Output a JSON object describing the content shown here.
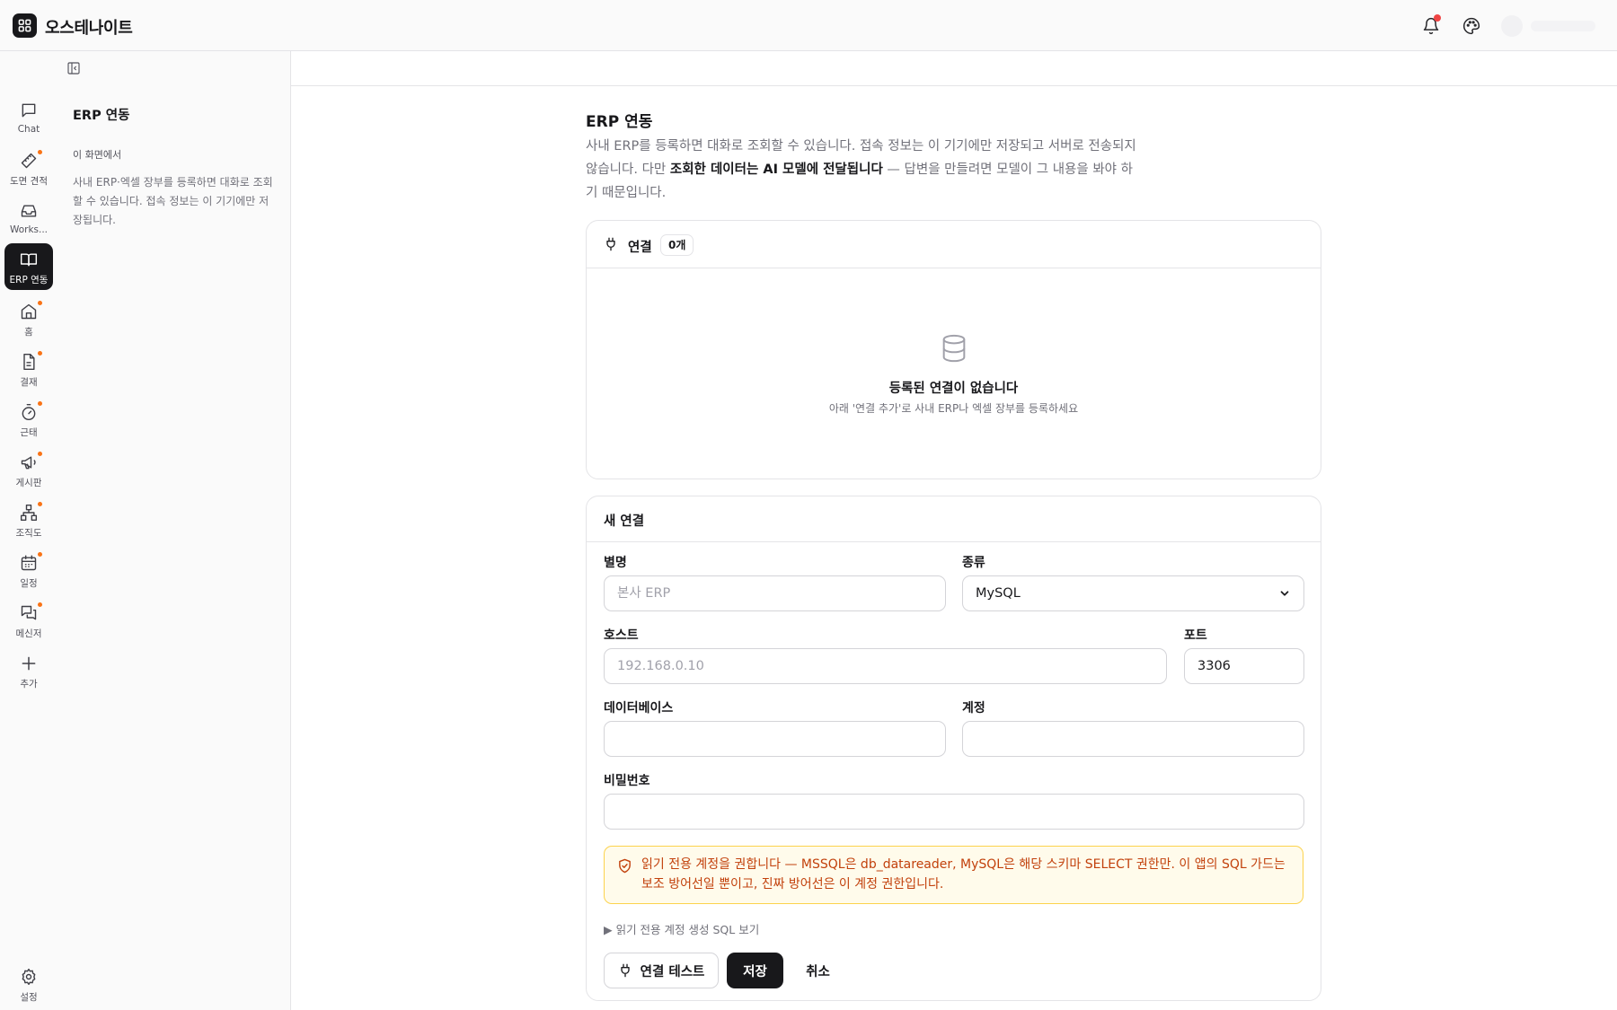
{
  "app": {
    "name": "오스테나이트"
  },
  "topbar": {
    "icons": [
      "bell-icon",
      "palette-icon"
    ],
    "notification_dot_color": "#ef4444"
  },
  "rail": {
    "items": [
      {
        "label": "Chat",
        "icon": "chat-icon",
        "badge": false,
        "active": false
      },
      {
        "label": "도면 견적",
        "icon": "ruler-icon",
        "badge": true,
        "active": false
      },
      {
        "label": "Works...",
        "icon": "inbox-icon",
        "badge": false,
        "active": false
      },
      {
        "label": "ERP 연동",
        "icon": "book-open-icon",
        "badge": false,
        "active": true
      },
      {
        "label": "홈",
        "icon": "home-icon",
        "badge": true,
        "active": false
      },
      {
        "label": "결재",
        "icon": "document-icon",
        "badge": true,
        "active": false
      },
      {
        "label": "근태",
        "icon": "timer-icon",
        "badge": true,
        "active": false
      },
      {
        "label": "게시판",
        "icon": "megaphone-icon",
        "badge": true,
        "active": false
      },
      {
        "label": "조직도",
        "icon": "org-chart-icon",
        "badge": true,
        "active": false
      },
      {
        "label": "일정",
        "icon": "calendar-icon",
        "badge": true,
        "active": false
      },
      {
        "label": "메신저",
        "icon": "messages-icon",
        "badge": true,
        "active": false
      },
      {
        "label": "추가",
        "icon": "plus-icon",
        "badge": false,
        "active": false
      }
    ],
    "settings_label": "설정",
    "badge_color": "#f97316"
  },
  "panel": {
    "title": "ERP 연동",
    "subtitle": "이 화면에서",
    "description": "사내 ERP·엑셀 장부를 등록하면 대화로 조회할 수 있습니다. 접속 정보는 이 기기에만 저장됩니다."
  },
  "main": {
    "title": "ERP 연동",
    "desc_part1": "사내 ERP를 등록하면 대화로 조회할 수 있습니다. 접속 정보는 이 기기에만 저장되고 서버로 전송되지 않습니다. 다만 ",
    "desc_bold": "조회한 데이터는 AI 모델에 전달됩니다",
    "desc_part2": " — 답변을 만들려면 모델이 그 내용을 봐야 하기 때문입니다."
  },
  "connections": {
    "title": "연결",
    "count": "0개",
    "empty_title": "등록된 연결이 없습니다",
    "empty_sub": "아래 '연결 추가'로 사내 ERP나 엑셀 장부를 등록하세요"
  },
  "form": {
    "title": "새 연결",
    "alias_label": "별명",
    "alias_placeholder": "본사 ERP",
    "type_label": "종류",
    "type_value": "MySQL",
    "host_label": "호스트",
    "host_placeholder": "192.168.0.10",
    "port_label": "포트",
    "port_value": "3306",
    "db_label": "데이터베이스",
    "account_label": "계정",
    "password_label": "비밀번호",
    "notice": "읽기 전용 계정을 권합니다 — MSSQL은 db_datareader, MySQL은 해당 스키마 SELECT 권한만. 이 앱의 SQL 가드는 보조 방어선일 뿐이고, 진짜 방어선은 이 계정 권한입니다.",
    "sql_toggle": "▶ 읽기 전용 계정 생성 SQL 보기",
    "test_button": "연결 테스트",
    "save_button": "저장",
    "cancel_button": "취소"
  },
  "colors": {
    "accent": "#18181b",
    "warning_text": "#c2410c",
    "warning_bg": "#fffbeb",
    "warning_border": "#fcd34d"
  }
}
